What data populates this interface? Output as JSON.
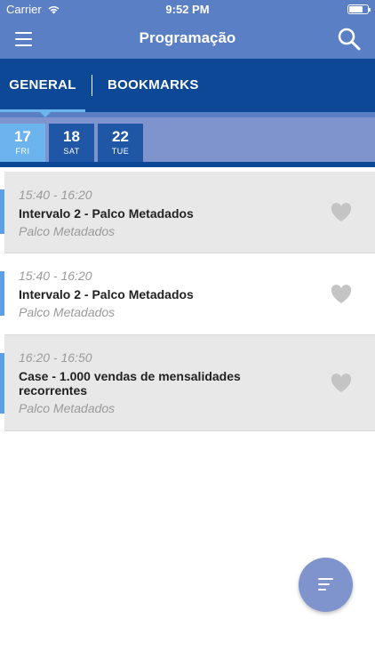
{
  "status_bar": {
    "carrier": "Carrier",
    "time": "9:52 PM"
  },
  "nav": {
    "title": "Programação",
    "menu_icon": "hamburger-menu-icon",
    "search_icon": "search-icon"
  },
  "tabs": [
    {
      "label": "GENERAL",
      "active": true
    },
    {
      "label": "BOOKMARKS",
      "active": false
    }
  ],
  "dates": [
    {
      "day": "17",
      "weekday": "FRI",
      "active": true
    },
    {
      "day": "18",
      "weekday": "SAT",
      "active": false
    },
    {
      "day": "22",
      "weekday": "TUE",
      "active": false
    }
  ],
  "sessions": [
    {
      "time": "15:40 - 16:20",
      "title": "Intervalo 2 - Palco Metadados",
      "venue": "Palco Metadados",
      "bookmarked": false
    },
    {
      "time": "15:40 - 16:20",
      "title": "Intervalo 2 - Palco Metadados",
      "venue": "Palco Metadados",
      "bookmarked": false
    },
    {
      "time": "16:20 - 16:50",
      "title": "Case - 1.000 vendas de mensalidades recorrentes",
      "venue": "Palco Metadados",
      "bookmarked": false
    }
  ],
  "fab": {
    "icon": "filter-icon"
  },
  "colors": {
    "primary": "#5b7fc4",
    "dark": "#0d4896",
    "accent": "#6cb4ee",
    "strip": "#7f93cc"
  }
}
